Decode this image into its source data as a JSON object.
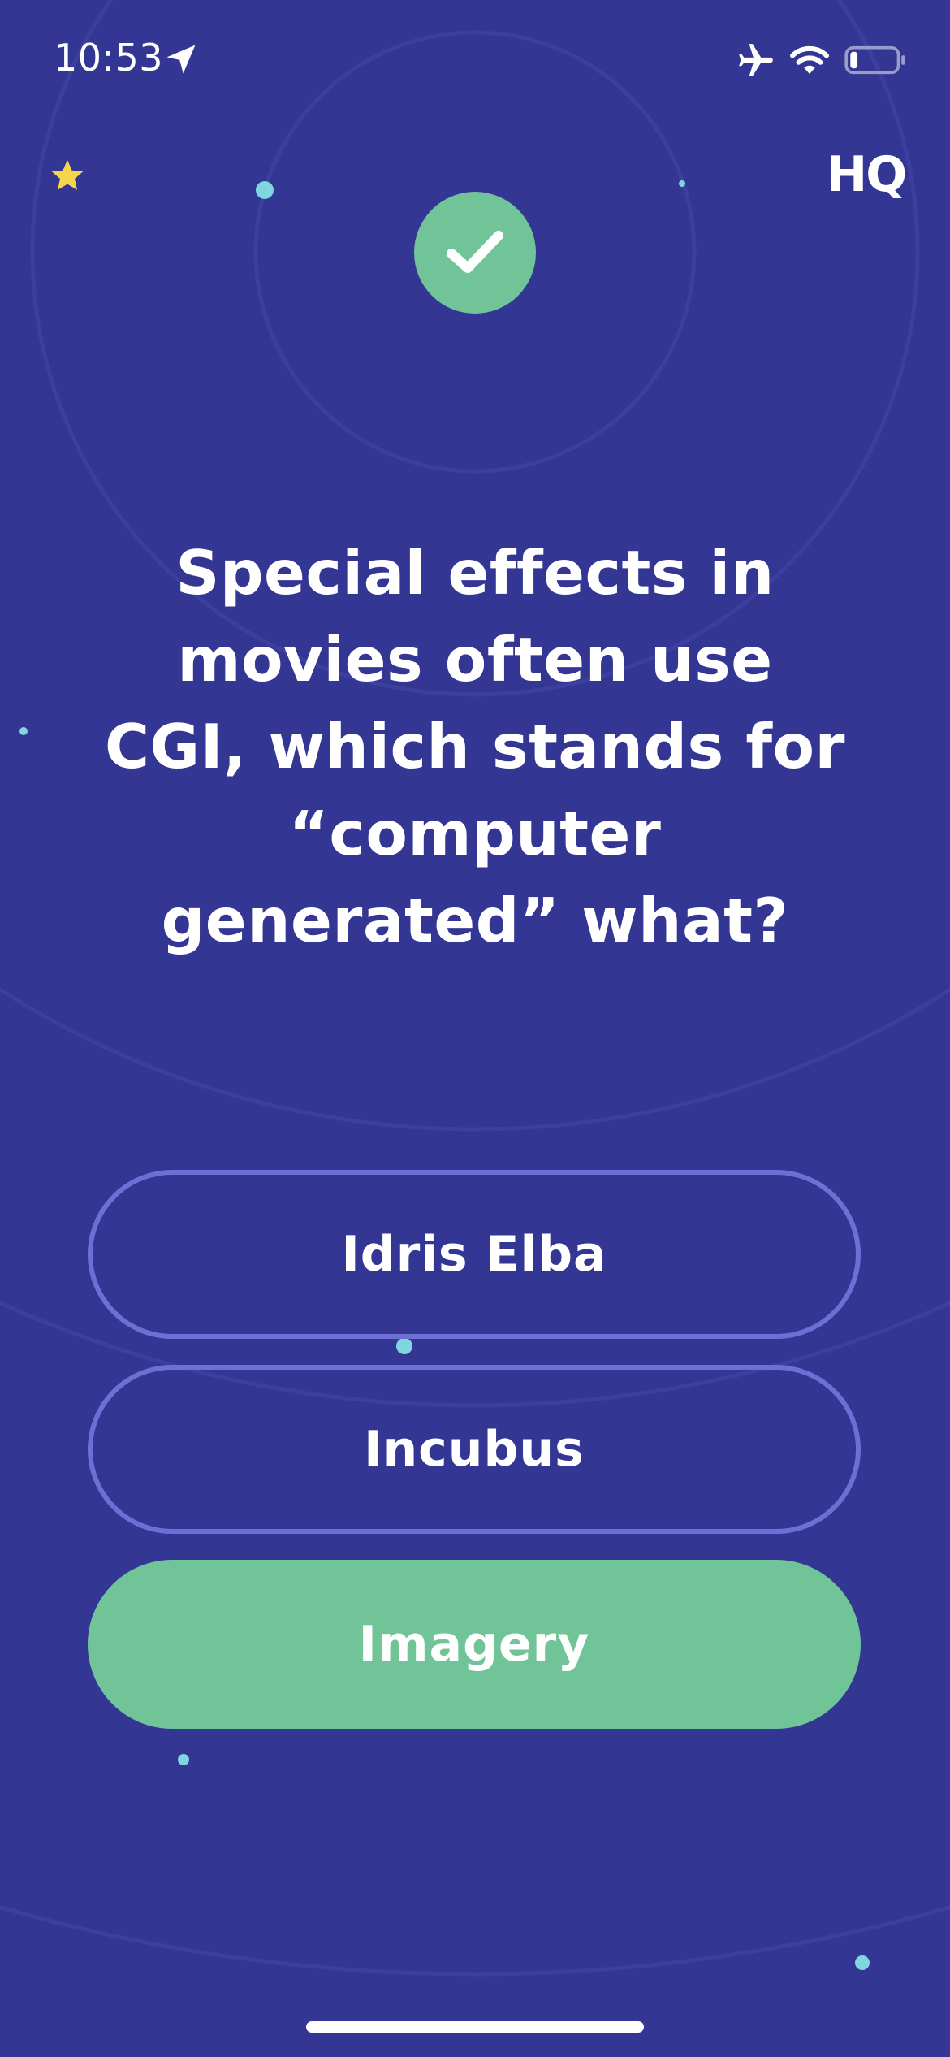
{
  "status_bar": {
    "time": "10:53",
    "icons": [
      "location-arrow-icon",
      "airplane-icon",
      "wifi-icon",
      "battery-low-icon"
    ]
  },
  "header": {
    "star_icon": "star-icon",
    "logo": "HQ"
  },
  "result": {
    "icon": "checkmark-icon",
    "status": "correct"
  },
  "question": {
    "text": "Special effects in movies often use CGI, which stands for “computer generated” what?"
  },
  "answers": [
    {
      "label": "Idris Elba",
      "state": "unselected"
    },
    {
      "label": "Incubus",
      "state": "unselected"
    },
    {
      "label": "Imagery",
      "state": "correct"
    }
  ],
  "colors": {
    "background": "#333693",
    "correct_green": "#71c497",
    "outline_purple": "#6e6fd4",
    "star_yellow": "#f6d54a",
    "dot_cyan": "#7fd6df"
  }
}
